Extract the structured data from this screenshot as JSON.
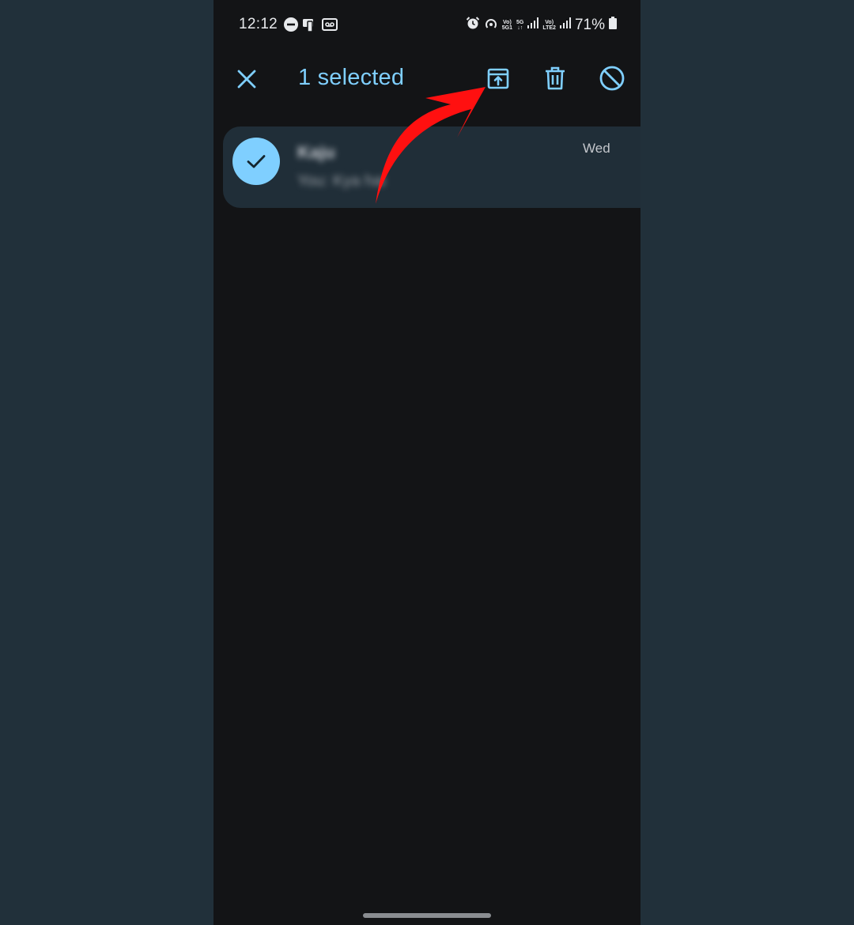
{
  "status_bar": {
    "time": "12:12",
    "battery": "71%",
    "sim1_label_top": "Vo)",
    "sim1_label_bottom": "5G1",
    "net_label": "5G",
    "sim2_label_top": "Vo)",
    "sim2_label_bottom": "LTE2",
    "icons": [
      "dnd-icon",
      "nfc-icon",
      "cassette-icon",
      "alarm-icon",
      "hotspot-icon",
      "signal-icon",
      "battery-icon"
    ]
  },
  "toolbar": {
    "selected_label": "1 selected",
    "actions": [
      "close-icon",
      "archive-icon",
      "delete-icon",
      "block-icon"
    ]
  },
  "conversation": {
    "name": "Kaju",
    "snippet": "You: Kya hai",
    "date": "Wed",
    "selected": true
  },
  "colors": {
    "accent": "#7fcfff",
    "background": "#131416",
    "row_selected": "#202e38",
    "outer": "#21303a",
    "annotation": "#ff1010"
  }
}
